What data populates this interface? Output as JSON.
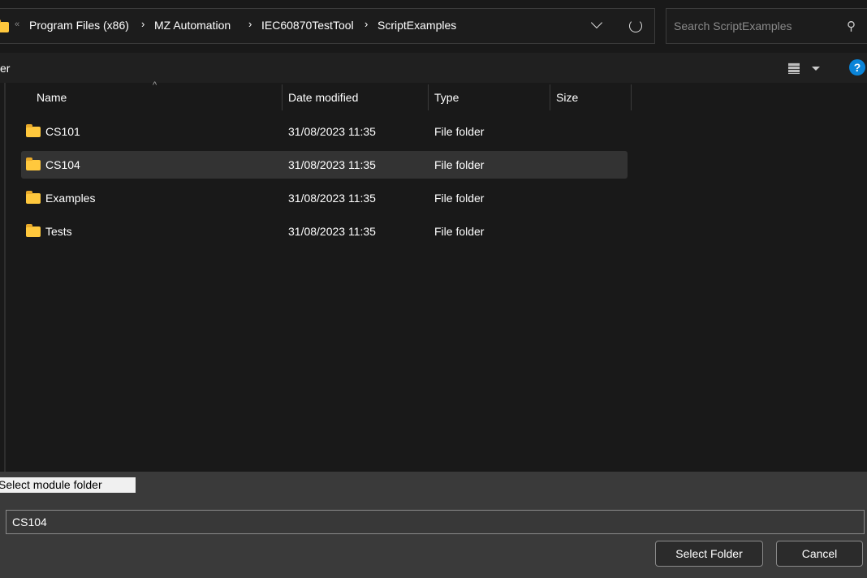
{
  "breadcrumb": [
    "Program Files (x86)",
    "MZ Automation",
    "IEC60870TestTool",
    "ScriptExamples"
  ],
  "search": {
    "placeholder": "Search ScriptExamples"
  },
  "toolbar": {
    "partial_label": "er"
  },
  "columns": {
    "name": "Name",
    "date": "Date modified",
    "type": "Type",
    "size": "Size"
  },
  "rows": [
    {
      "name": "CS101",
      "date": "31/08/2023 11:35",
      "type": "File folder"
    },
    {
      "name": "CS104",
      "date": "31/08/2023 11:35",
      "type": "File folder"
    },
    {
      "name": "Examples",
      "date": "31/08/2023 11:35",
      "type": "File folder"
    },
    {
      "name": "Tests",
      "date": "31/08/2023 11:35",
      "type": "File folder"
    }
  ],
  "selected_row": "CS104",
  "dialog_title": "Select module folder",
  "folder_input": {
    "value": "CS104"
  },
  "buttons": {
    "select": "Select Folder",
    "cancel": "Cancel"
  },
  "colors": {
    "accent": "#0a84d8",
    "folder": "#ffc83d"
  }
}
